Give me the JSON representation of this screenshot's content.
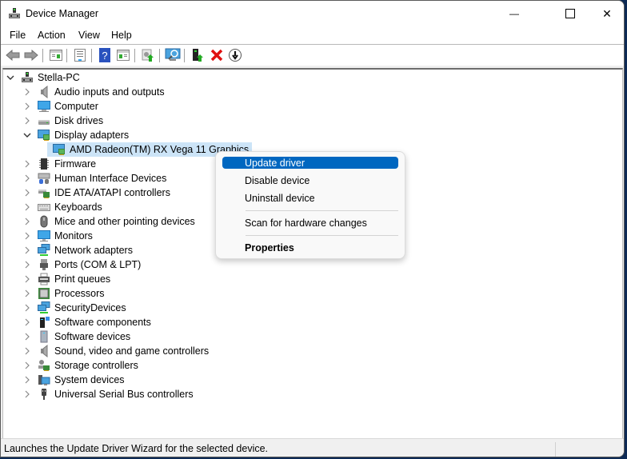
{
  "window": {
    "title": "Device Manager",
    "icon": "device-manager-icon",
    "controls": {
      "minimize": "—",
      "maximize": "☐",
      "close": "✕"
    }
  },
  "menu": [
    "File",
    "Action",
    "View",
    "Help"
  ],
  "toolbar": [
    {
      "name": "back-icon"
    },
    {
      "name": "forward-icon"
    },
    {
      "name": "show-hide-console-tree-icon"
    },
    {
      "name": "properties-icon"
    },
    {
      "name": "help-icon"
    },
    {
      "name": "show-hide-action-pane-icon"
    },
    {
      "name": "update-driver-icon"
    },
    {
      "name": "scan-hardware-icon"
    },
    {
      "name": "add-legacy-hardware-icon"
    },
    {
      "name": "uninstall-device-icon"
    },
    {
      "name": "disable-device-icon"
    }
  ],
  "tree": {
    "root": "Stella-PC",
    "items": [
      {
        "label": "Audio inputs and outputs",
        "icon": "speaker-icon",
        "expanded": false
      },
      {
        "label": "Computer",
        "icon": "computer-icon",
        "expanded": false
      },
      {
        "label": "Disk drives",
        "icon": "disk-drive-icon",
        "expanded": false
      },
      {
        "label": "Display adapters",
        "icon": "display-adapter-icon",
        "expanded": true,
        "children": [
          {
            "label": "AMD Radeon(TM) RX Vega 11 Graphics",
            "icon": "display-adapter-icon",
            "selected": true
          }
        ]
      },
      {
        "label": "Firmware",
        "icon": "firmware-chip-icon",
        "expanded": false
      },
      {
        "label": "Human Interface Devices",
        "icon": "hid-icon",
        "expanded": false
      },
      {
        "label": "IDE ATA/ATAPI controllers",
        "icon": "ide-controller-icon",
        "expanded": false
      },
      {
        "label": "Keyboards",
        "icon": "keyboard-icon",
        "expanded": false
      },
      {
        "label": "Mice and other pointing devices",
        "icon": "mouse-icon",
        "expanded": false
      },
      {
        "label": "Monitors",
        "icon": "monitor-icon",
        "expanded": false
      },
      {
        "label": "Network adapters",
        "icon": "network-adapter-icon",
        "expanded": false
      },
      {
        "label": "Ports (COM & LPT)",
        "icon": "port-icon",
        "expanded": false
      },
      {
        "label": "Print queues",
        "icon": "printer-icon",
        "expanded": false
      },
      {
        "label": "Processors",
        "icon": "processor-icon",
        "expanded": false
      },
      {
        "label": "SecurityDevices",
        "icon": "security-device-icon",
        "expanded": false
      },
      {
        "label": "Software components",
        "icon": "software-component-icon",
        "expanded": false
      },
      {
        "label": "Software devices",
        "icon": "software-device-icon",
        "expanded": false
      },
      {
        "label": "Sound, video and game controllers",
        "icon": "speaker-icon",
        "expanded": false
      },
      {
        "label": "Storage controllers",
        "icon": "storage-controller-icon",
        "expanded": false
      },
      {
        "label": "System devices",
        "icon": "system-device-icon",
        "expanded": false
      },
      {
        "label": "Universal Serial Bus controllers",
        "icon": "usb-icon",
        "expanded": false
      }
    ]
  },
  "context_menu": {
    "items": [
      {
        "label": "Update driver",
        "highlighted": true
      },
      {
        "label": "Disable device"
      },
      {
        "label": "Uninstall device"
      },
      {
        "separator": true
      },
      {
        "label": "Scan for hardware changes"
      },
      {
        "separator": true
      },
      {
        "label": "Properties",
        "bold": true
      }
    ]
  },
  "status_bar": {
    "text": "Launches the Update Driver Wizard for the selected device."
  }
}
